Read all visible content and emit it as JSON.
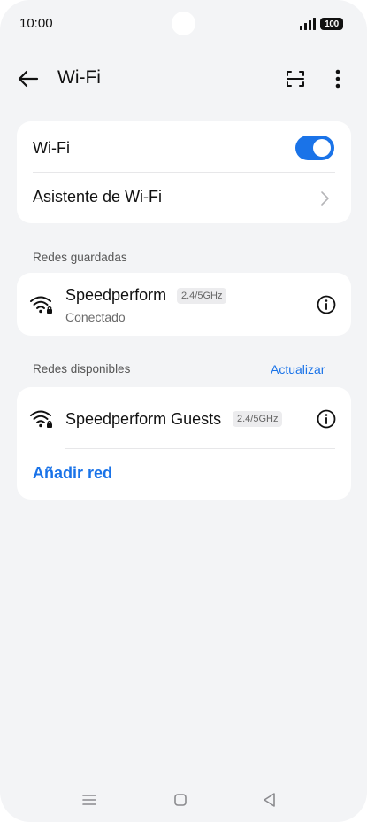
{
  "status_bar": {
    "time": "10:00",
    "battery": "100"
  },
  "header": {
    "title": "Wi-Fi"
  },
  "wifi_card": {
    "toggle_label": "Wi-Fi",
    "toggle_on": true,
    "assistant_label": "Asistente de Wi-Fi"
  },
  "saved_networks": {
    "section_label": "Redes guardadas",
    "items": [
      {
        "name": "Speedperform",
        "band": "2.4/5GHz",
        "status": "Conectado"
      }
    ]
  },
  "available_networks": {
    "section_label": "Redes disponibles",
    "refresh_label": "Actualizar",
    "items": [
      {
        "name": "Speedperform Guests",
        "band": "2.4/5GHz"
      }
    ],
    "add_network_label": "Añadir red"
  },
  "colors": {
    "accent": "#1a73e8",
    "background": "#f3f4f6",
    "card": "#ffffff"
  },
  "icons": [
    "back-arrow-icon",
    "qr-scan-icon",
    "more-vert-icon",
    "chevron-right-icon",
    "wifi-lock-icon",
    "info-icon",
    "menu-icon",
    "home-square-icon",
    "back-triangle-icon"
  ]
}
